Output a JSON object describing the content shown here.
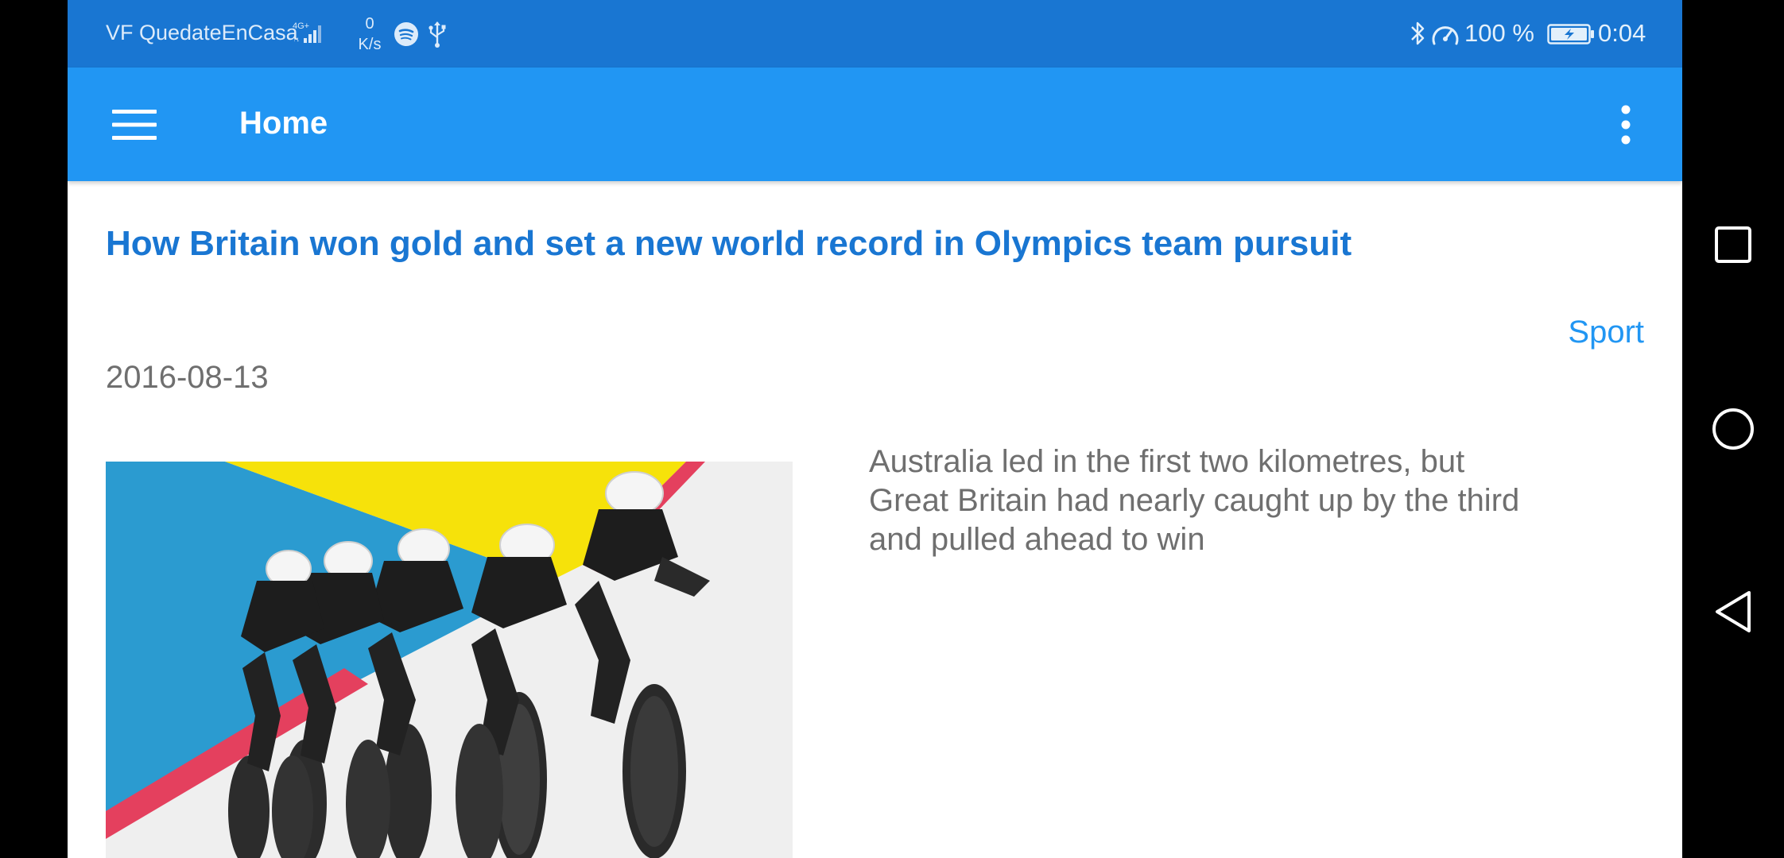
{
  "status_bar": {
    "carrier": "VF QuedateEnCasa",
    "network_type_icon": "4g-plus-icon",
    "data_speed_value": "0",
    "data_speed_unit": "K/s",
    "icons": [
      "signal-icon",
      "spotify-icon",
      "usb-icon",
      "bluetooth-icon",
      "speed-gauge-icon",
      "battery-charging-icon"
    ],
    "battery_percent": "100 %",
    "time": "0:04",
    "background_color": "#1976D2"
  },
  "app_bar": {
    "title": "Home",
    "menu_icon": "hamburger-menu-icon",
    "overflow_icon": "more-vertical-icon",
    "background_color": "#2196F3"
  },
  "article": {
    "title": "How Britain won gold and set a new world record in Olympics team pursuit",
    "category": "Sport",
    "date": "2016-08-13",
    "summary": "Australia led in the first two kilometres, but Great Britain had nearly caught up by the third and pulled ahead to win",
    "image_icon": "cyclists-team-pursuit-image",
    "title_color": "#1976D2",
    "category_color": "#2196F3"
  },
  "nav_bar": {
    "icons": [
      "recents-square-icon",
      "home-circle-icon",
      "back-triangle-icon"
    ]
  }
}
